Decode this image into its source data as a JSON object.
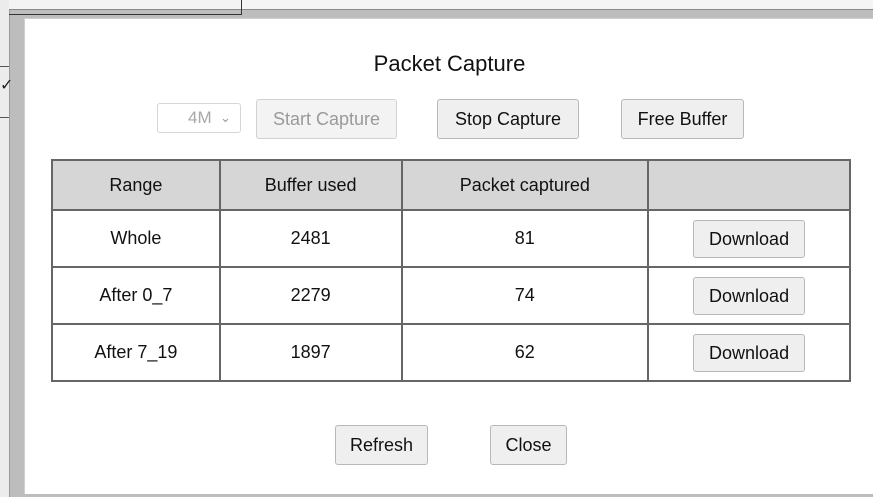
{
  "dialog": {
    "title": "Packet Capture",
    "buffer_select": {
      "value": "4M",
      "icon": "chevron-down-icon"
    },
    "start_label": "Start Capture",
    "stop_label": "Stop Capture",
    "free_label": "Free Buffer",
    "refresh_label": "Refresh",
    "close_label": "Close"
  },
  "table": {
    "headers": [
      "Range",
      "Buffer used",
      "Packet captured",
      ""
    ],
    "rows": [
      {
        "range": "Whole",
        "buffer_used": "2481",
        "packets": "81",
        "action": "Download"
      },
      {
        "range": "After 0_7",
        "buffer_used": "2279",
        "packets": "74",
        "action": "Download"
      },
      {
        "range": "After 7_19",
        "buffer_used": "1897",
        "packets": "62",
        "action": "Download"
      }
    ]
  },
  "background": {
    "check_glyph": "✓"
  }
}
